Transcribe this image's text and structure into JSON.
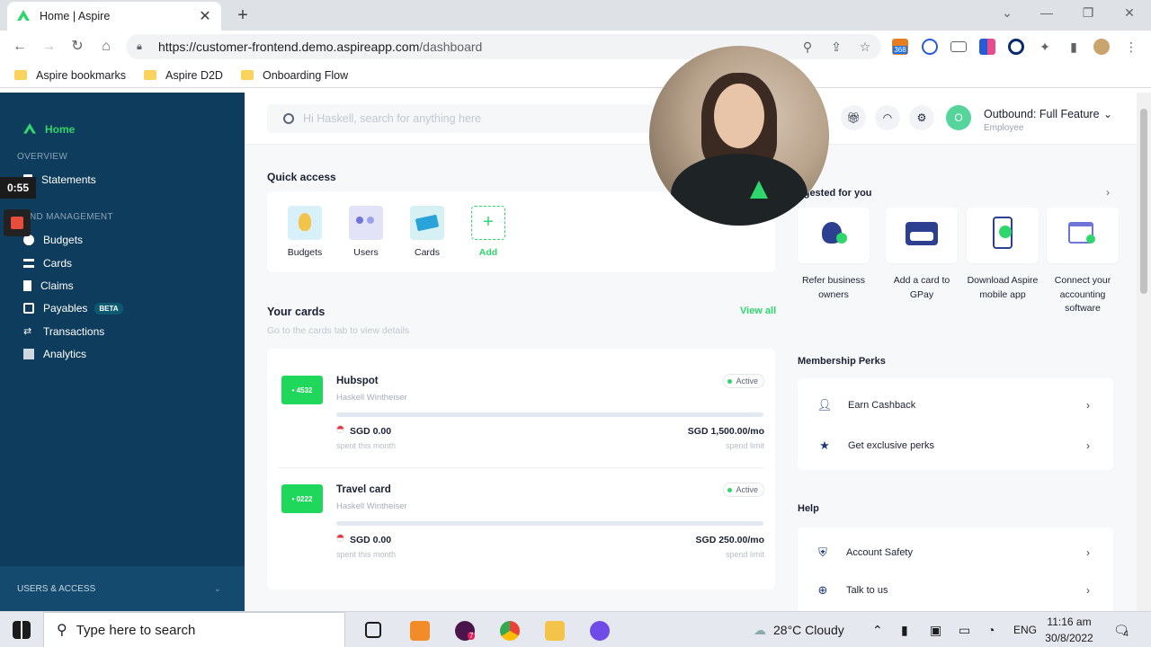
{
  "browser": {
    "tab_title": "Home | Aspire",
    "url_host": "https://customer-frontend.demo.aspireapp.com",
    "url_path": "/dashboard",
    "bookmarks": [
      "Aspire bookmarks",
      "Aspire D2D",
      "Onboarding Flow"
    ],
    "ext_badge": "368"
  },
  "sidebar": {
    "home": "Home",
    "overview": "OVERVIEW",
    "statements": "Statements",
    "spend_management": "ND MANAGEMENT",
    "budgets": "Budgets",
    "cards": "Cards",
    "claims": "Claims",
    "payables": "Payables",
    "beta": "BETA",
    "transactions": "Transactions",
    "analytics": "Analytics",
    "users_access": "USERS & ACCESS"
  },
  "recorder": {
    "timer": "0:55"
  },
  "topbar": {
    "search_placeholder": "Hi Haskell, search for anything here",
    "avatar_initial": "O",
    "account_name": "Outbound: Full Feature",
    "account_role": "Employee"
  },
  "quick_access": {
    "title": "Quick access",
    "items": [
      {
        "label": "Budgets"
      },
      {
        "label": "Users"
      },
      {
        "label": "Cards"
      },
      {
        "label": "Add"
      }
    ]
  },
  "your_cards": {
    "title": "Your cards",
    "hint": "Go to the cards tab to view details",
    "view_all": "View all",
    "cards": [
      {
        "chip": "• 4532",
        "name": "Hubspot",
        "owner": "Haskell Wintheiser",
        "status": "Active",
        "spent": "SGD 0.00",
        "spent_label": "spent this month",
        "limit": "SGD 1,500.00/mo",
        "limit_label": "spend limit"
      },
      {
        "chip": "• 0222",
        "name": "Travel card",
        "owner": "Haskell Wintheiser",
        "status": "Active",
        "spent": "SGD 0.00",
        "spent_label": "spent this month",
        "limit": "SGD 250.00/mo",
        "limit_label": "spend limit"
      }
    ]
  },
  "suggested": {
    "title": "ggested for you",
    "items": [
      {
        "label": "Refer business owners"
      },
      {
        "label": "Add a card to GPay"
      },
      {
        "label": "Download Aspire mobile app"
      },
      {
        "label": "Connect your accounting software"
      }
    ]
  },
  "perks": {
    "title": "Membership Perks",
    "items": [
      {
        "label": "Earn Cashback"
      },
      {
        "label": "Get exclusive perks"
      }
    ]
  },
  "help": {
    "title": "Help",
    "items": [
      {
        "label": "Account Safety"
      },
      {
        "label": "Talk to us"
      }
    ]
  },
  "taskbar": {
    "search_placeholder": "Type here to search",
    "weather": "28°C  Cloudy",
    "lang": "ENG",
    "time": "11:16 am",
    "date": "30/8/2022",
    "notif_count": "4",
    "slack_badge": "7"
  },
  "colors": {
    "brand_green": "#2fd66b",
    "sidebar_bg": "#0e3c5c",
    "card_chip": "#1fd85b"
  }
}
